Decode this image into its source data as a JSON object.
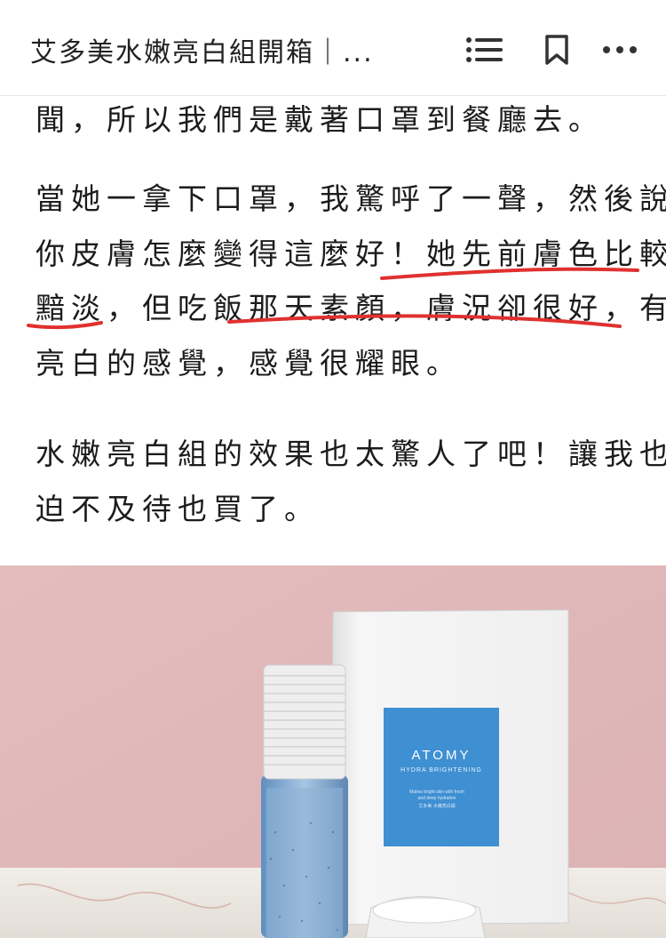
{
  "header": {
    "title": "艾多美水嫩亮白組開箱｜...",
    "icons": [
      "list-icon",
      "bookmark-icon",
      "more-icon"
    ]
  },
  "article": {
    "paragraph1": {
      "line1": "聞，所以我們是戴著口罩到餐廳去。"
    },
    "paragraph2": {
      "line1": "當她一拿下口罩，我驚呼了一聲，然後說",
      "line2": "你皮膚怎麼變得這麼好！她先前膚色比較",
      "line3": "黯淡，但吃飯那天素顏，膚況卻很好，有",
      "line4": "亮白的感覺，感覺很耀眼。"
    },
    "paragraph3": {
      "line1": "水嫩亮白組的效果也太驚人了吧！讓我也",
      "line2": "迫不及待也買了。"
    },
    "annotation_color": "#e0312f"
  },
  "photo": {
    "box_brand": "ATOMY",
    "box_line": "HYDRA BRIGHTENING",
    "box_fine_print": [
      "Makes bright skin with fresh",
      "and deep hydration",
      "艾多美 水嫩亮白組"
    ],
    "colors": {
      "wall": "#e6c2c2",
      "box": "#f4f4f4",
      "label": "#3f8fd3",
      "bottle": "#7eaad1",
      "cap": "#eaeaea",
      "counter": "#ece8e4"
    }
  }
}
